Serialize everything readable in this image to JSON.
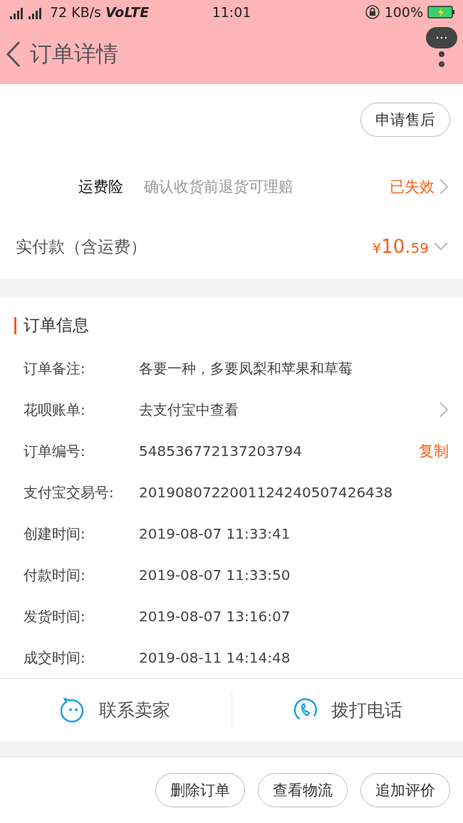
{
  "status_bar": {
    "network_speed": "72 KB/s",
    "volte": "VoLTE",
    "time": "11:01",
    "battery": "100%"
  },
  "header": {
    "title": "订单详情"
  },
  "after_sale_button": "申请售后",
  "insurance": {
    "label": "运费险",
    "description": "确认收货前退货可理赔",
    "status": "已失效"
  },
  "payment": {
    "label": "实付款（含运费）",
    "currency": "¥",
    "amount_main": "10.",
    "amount_cents": "59"
  },
  "order_info": {
    "title": "订单信息",
    "rows": [
      {
        "label": "订单备注:",
        "value": "各要一种，多要凤梨和苹果和草莓",
        "kind": "plain"
      },
      {
        "label": "花呗账单:",
        "value": "去支付宝中查看",
        "kind": "chevron"
      },
      {
        "label": "订单编号:",
        "value": "548536772137203794",
        "kind": "action",
        "action": "复制"
      },
      {
        "label": "支付宝交易号:",
        "value": "2019080722001124240507426438",
        "kind": "plain"
      },
      {
        "label": "创建时间:",
        "value": "2019-08-07 11:33:41",
        "kind": "plain"
      },
      {
        "label": "付款时间:",
        "value": "2019-08-07 11:33:50",
        "kind": "plain"
      },
      {
        "label": "发货时间:",
        "value": "2019-08-07 13:16:07",
        "kind": "plain"
      },
      {
        "label": "成交时间:",
        "value": "2019-08-11 14:14:48",
        "kind": "plain"
      }
    ]
  },
  "contact": [
    {
      "label": "联系卖家",
      "kind": "chat"
    },
    {
      "label": "拨打电话",
      "kind": "phone"
    }
  ],
  "bottom_buttons": [
    "删除订单",
    "查看物流",
    "追加评价"
  ]
}
